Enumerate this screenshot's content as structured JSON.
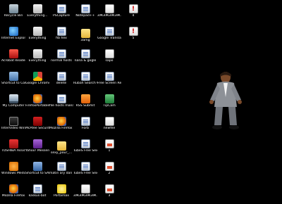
{
  "desktop": {
    "background": "#000000",
    "icons": [
      {
        "label": "Recycle Bin",
        "kind": "bin"
      },
      {
        "label": "Everything...",
        "kind": "every"
      },
      {
        "label": "PSCapture",
        "kind": "doc"
      },
      {
        "label": "Notepad++",
        "kind": "doc"
      },
      {
        "label": "ЭЖЭЖЭЖЭЖ... - Panelaux...",
        "kind": "txt"
      },
      {
        "label": "4",
        "kind": "warn"
      },
      {
        "label": "Internet Explorer",
        "kind": "ie"
      },
      {
        "label": "Everything",
        "kind": "every"
      },
      {
        "label": "fib hex",
        "kind": "doc"
      },
      {
        "label": "3amg",
        "kind": "folder"
      },
      {
        "label": "Google Translate",
        "kind": "doc"
      },
      {
        "label": "5",
        "kind": "warn"
      },
      {
        "label": "Acrobat Reader 5.1",
        "kind": "acrobat"
      },
      {
        "label": "Everything",
        "kind": "every"
      },
      {
        "label": "normal hosts",
        "kind": "doc"
      },
      {
        "label": "nana & gogle",
        "kind": "doc"
      },
      {
        "label": "sapo",
        "kind": "txt"
      },
      {
        "label": "Shortcut to Control Panel",
        "kind": "cpanel"
      },
      {
        "label": "Google Chrome",
        "kind": "chrome"
      },
      {
        "label": "delete",
        "kind": "doc"
      },
      {
        "label": "Rubah Search Google",
        "kind": "doc"
      },
      {
        "label": "Free Screen Recorder",
        "kind": "doc"
      },
      {
        "label": "My Computer",
        "kind": "computer"
      },
      {
        "label": "FirefoxPortable",
        "kind": "firefox"
      },
      {
        "label": "file hosts mana",
        "kind": "doc"
      },
      {
        "label": "RSS Submit",
        "kind": "rss"
      },
      {
        "label": "TipCam",
        "kind": "xls"
      },
      {
        "label": "InterVideo WinDVD",
        "kind": "video"
      },
      {
        "label": "McAfee Security Sc...",
        "kind": "mcafee"
      },
      {
        "label": "Mozilla Firefox 4.0 Beta 1",
        "kind": "firefox"
      },
      {
        "label": "Forb",
        "kind": "doc"
      },
      {
        "label": "newfile",
        "kind": "txt"
      },
      {
        "label": "TOSHIBA Assist",
        "kind": "toshiba"
      },
      {
        "label": "Yahoo! Messenger",
        "kind": "yahoo"
      },
      {
        "label": "sexy_pour_...",
        "kind": "folder"
      },
      {
        "label": "TubeS Free Sex Videos ...",
        "kind": "doc"
      },
      {
        "label": "1",
        "kind": "num"
      },
      {
        "label": "Windows Media Player",
        "kind": "wmp"
      },
      {
        "label": "Shortcut to SARU",
        "kind": "saru"
      },
      {
        "label": "matin ary dan ceci",
        "kind": "doc"
      },
      {
        "label": "TubeS Free Sex Videos - ...",
        "kind": "doc"
      },
      {
        "label": "2",
        "kind": "num"
      },
      {
        "label": "Mozilla Firefox",
        "kind": "firefox"
      },
      {
        "label": "kaskus-bot",
        "kind": "doc"
      },
      {
        "label": "Portamax",
        "kind": "ducky"
      },
      {
        "label": "ЭЖЭЖЭЖЭЖ... - Panelaux...",
        "kind": "txt"
      },
      {
        "label": "3",
        "kind": "num"
      }
    ]
  }
}
